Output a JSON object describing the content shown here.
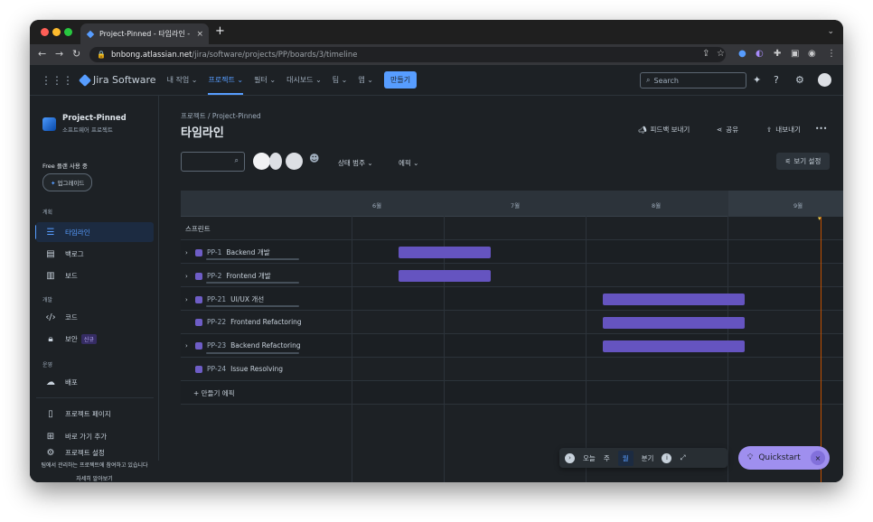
{
  "browser": {
    "tab_title": "Project-Pinned - 타임라인 - Jira",
    "tab_close": "×",
    "new_tab": "+",
    "url_host": "bnbong.atlassian.net",
    "url_path": "/jira/software/projects/PP/boards/3/timeline"
  },
  "topnav": {
    "product": "Jira Software",
    "items": [
      "내 작업 ⌄",
      "프로젝트 ⌄",
      "필터 ⌄",
      "대시보드 ⌄",
      "팀 ⌄",
      "앱 ⌄"
    ],
    "create": "만들기",
    "search_placeholder": "Search"
  },
  "sidebar": {
    "project_name": "Project-Pinned",
    "project_type": "소프트웨어 프로젝트",
    "free_plan": "Free 플랜 사용 중",
    "upgrade": "업그레이드",
    "sections": {
      "planning": "계획",
      "development": "개발",
      "operations": "운영"
    },
    "items": [
      {
        "label": "타임라인",
        "icon": "timeline-icon"
      },
      {
        "label": "백로그",
        "icon": "backlog-icon"
      },
      {
        "label": "보드",
        "icon": "board-icon"
      },
      {
        "label": "코드",
        "icon": "code-icon"
      },
      {
        "label": "보안",
        "icon": "lock-icon",
        "badge": "신규"
      },
      {
        "label": "배포",
        "icon": "cloud-icon"
      },
      {
        "label": "프로젝트 페이지",
        "icon": "page-icon"
      },
      {
        "label": "바로 가기 추가",
        "icon": "add-shortcut-icon"
      }
    ],
    "partial_item": "프로젝트 설정",
    "footer_text": "팀에서 관리하는 프로젝트에 참여하고 있습니다",
    "footer_link": "자세히 알아보기"
  },
  "main": {
    "breadcrumb": "프로젝트  /  Project-Pinned",
    "title": "타임라인",
    "feedback": "피드백 보내기",
    "share": "공유",
    "export": "내보내기",
    "more": "•••",
    "filters": {
      "status": "상태 범주 ⌄",
      "epic": "에픽 ⌄"
    },
    "view_settings": "보기 설정"
  },
  "timeline": {
    "months": [
      "6월",
      "7월",
      "8월",
      "9월"
    ],
    "sprint_label": "스프린트",
    "rows": [
      {
        "key": "PP-1",
        "name": "Backend 개발",
        "expandable": true,
        "start": 0.19,
        "end": 0.53
      },
      {
        "key": "PP-2",
        "name": "Frontend 개발",
        "expandable": true,
        "start": 0.19,
        "end": 0.53
      },
      {
        "key": "PP-21",
        "name": "UI/UX 개선",
        "expandable": true,
        "start": 2.0,
        "end": 3.0
      },
      {
        "key": "PP-22",
        "name": "Frontend Refactoring",
        "expandable": false,
        "start": 2.0,
        "end": 3.0
      },
      {
        "key": "PP-23",
        "name": "Backend Refactoring",
        "expandable": true,
        "start": 2.0,
        "end": 3.0
      },
      {
        "key": "PP-24",
        "name": "Issue Resolving",
        "expandable": false
      }
    ],
    "create_epic": "+ 만들기 에픽"
  },
  "toolbar": {
    "today": "오늘",
    "week": "주",
    "month": "월",
    "quarter": "분기"
  },
  "quickstart": {
    "label": "Quickstart",
    "close": "×"
  }
}
